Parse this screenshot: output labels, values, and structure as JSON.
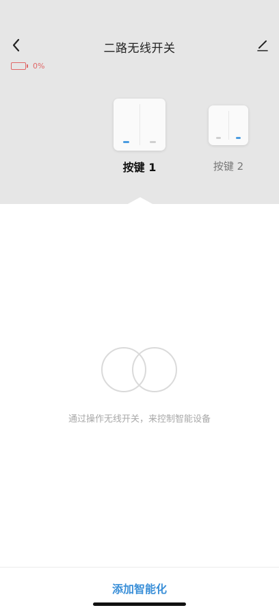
{
  "header": {
    "title": "二路无线开关",
    "back_icon": "chevron-left-icon",
    "edit_icon": "pencil-icon"
  },
  "battery": {
    "level_text": "0%",
    "level": 0,
    "color": "#e06666"
  },
  "keys": [
    {
      "label": "按键 1",
      "selected": true,
      "active_led": "left"
    },
    {
      "label": "按键 2",
      "selected": false,
      "active_led": "right"
    }
  ],
  "empty_state": {
    "illustration_icon": "two-rings-icon",
    "message": "通过操作无线开关，来控制智能设备"
  },
  "footer": {
    "add_label": "添加智能化"
  },
  "colors": {
    "header_bg": "#e6e6e6",
    "accent": "#3a8fd8",
    "led_on": "#4a9be0",
    "led_off": "#cfcfcf"
  }
}
